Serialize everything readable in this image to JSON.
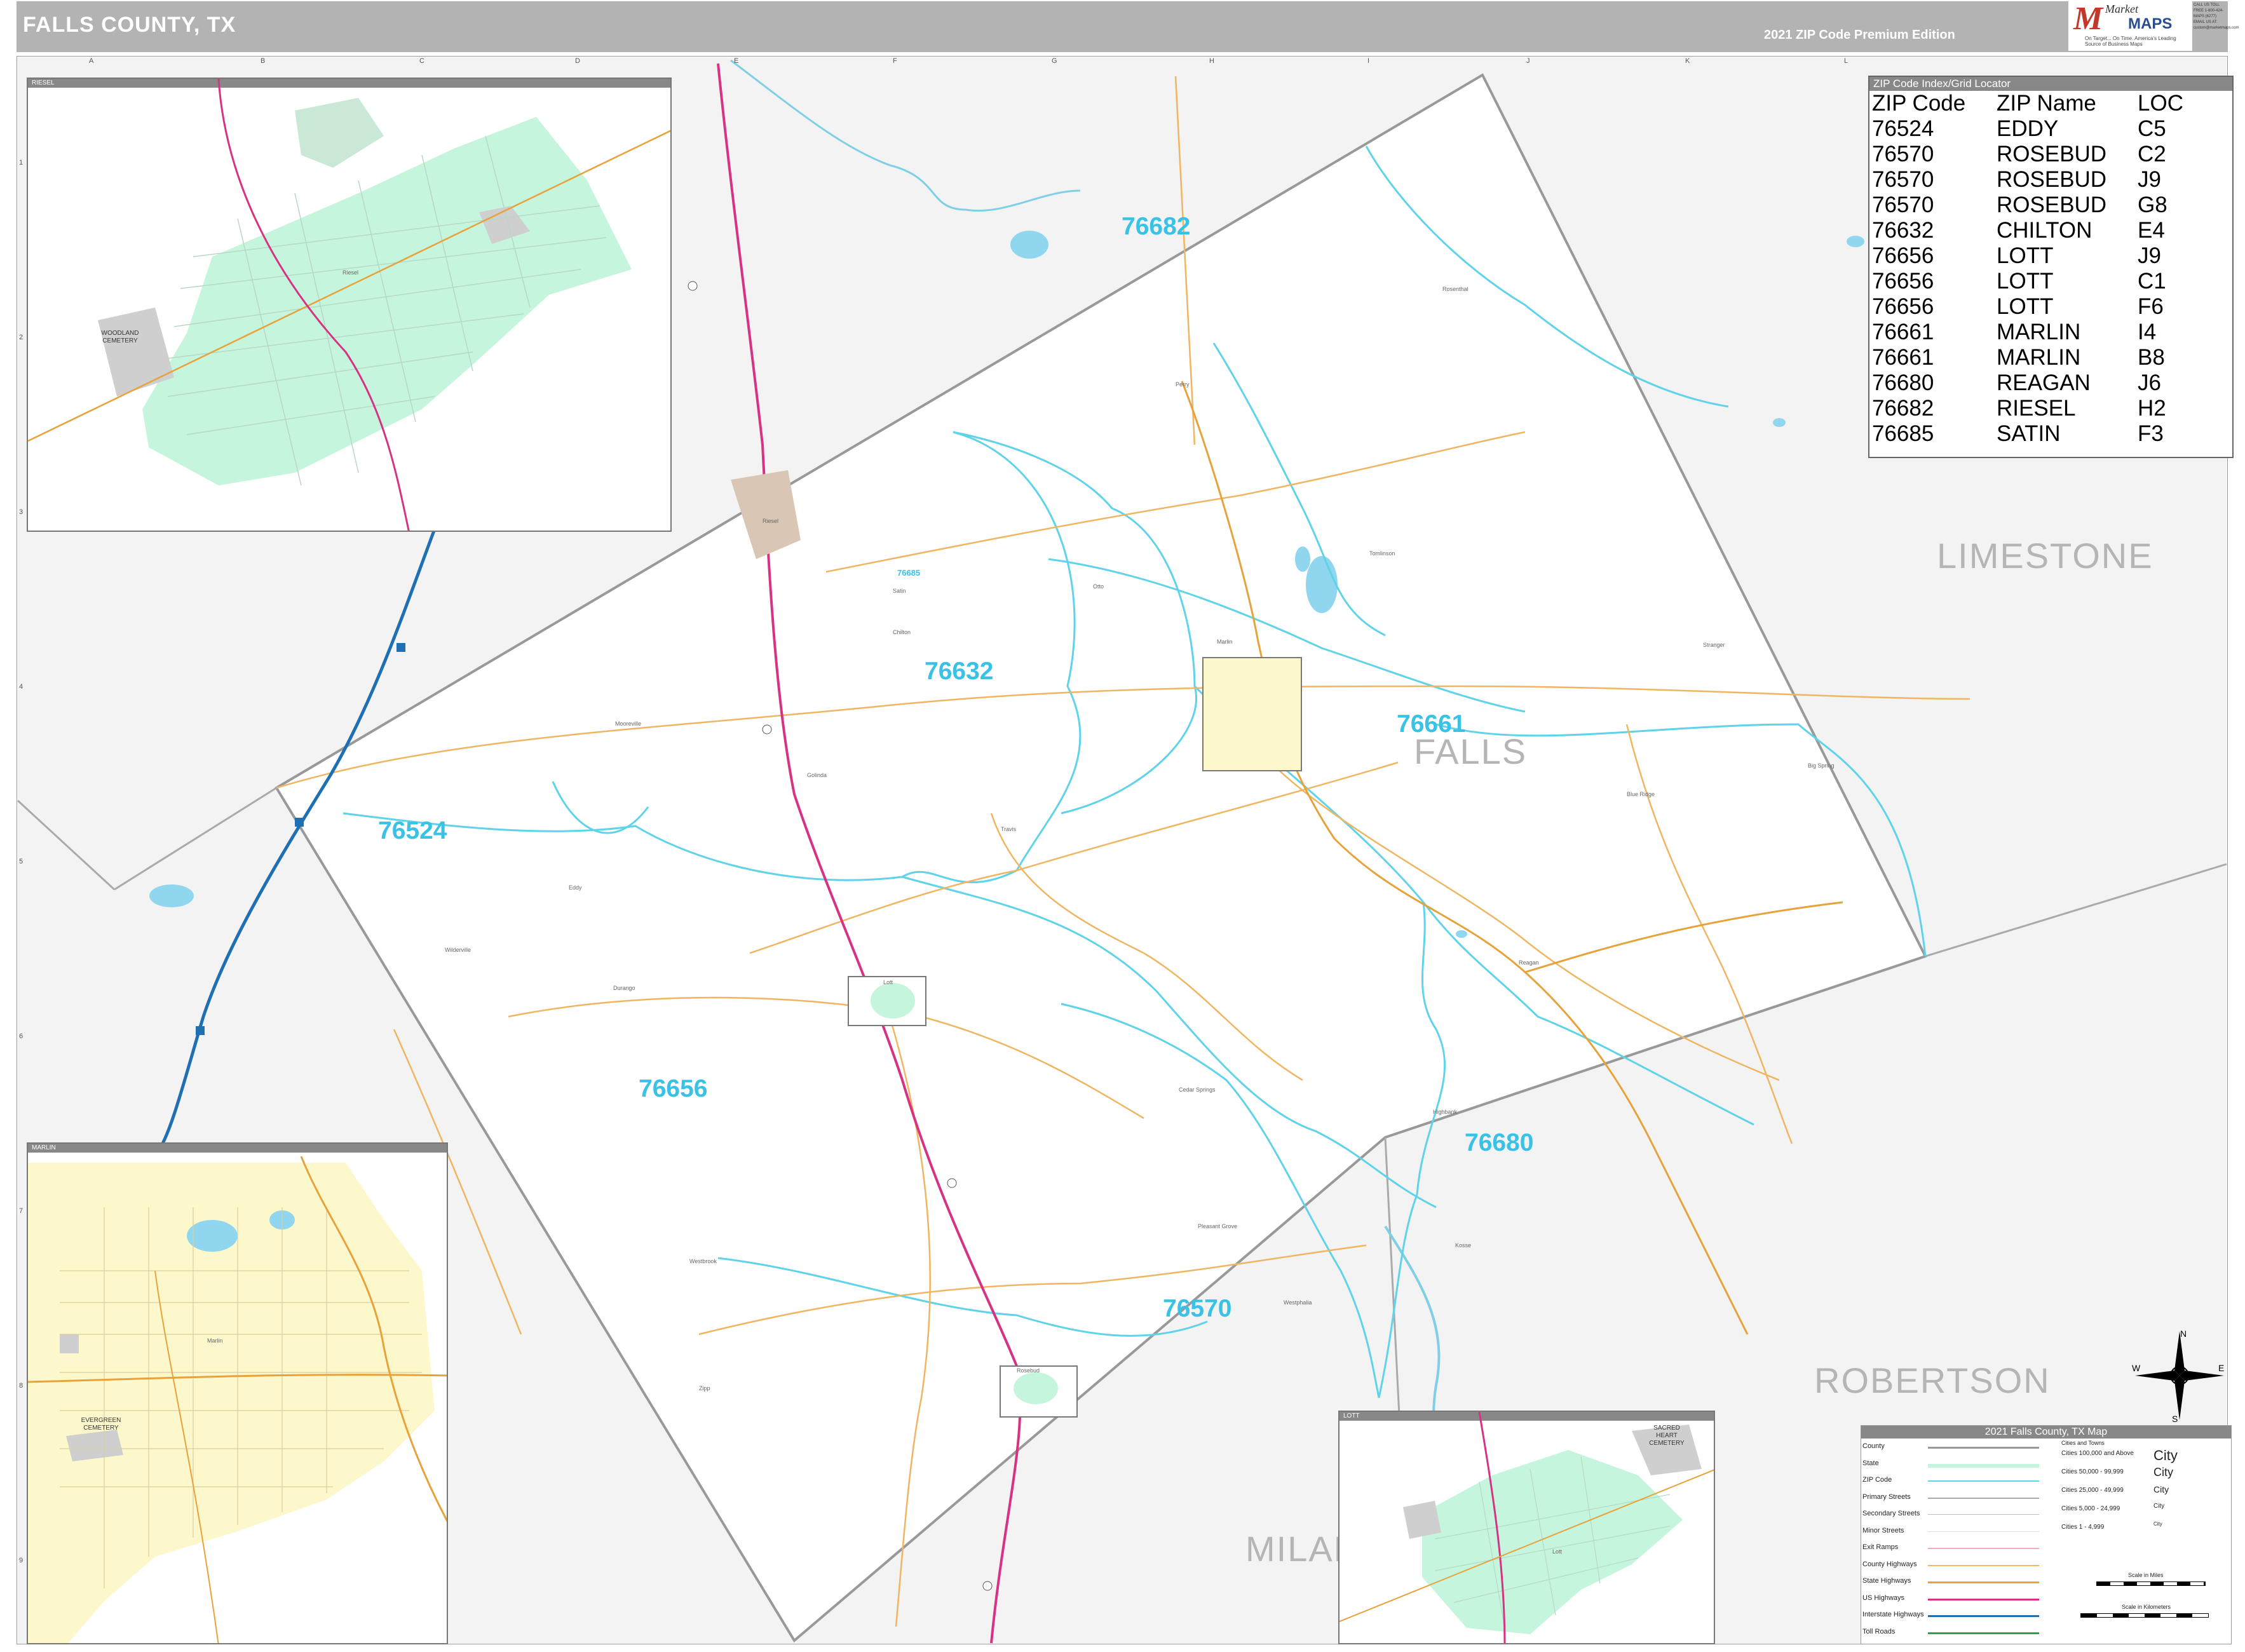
{
  "header": {
    "title": "FALLS COUNTY, TX",
    "edition": "2021 ZIP Code Premium Edition",
    "logo_top": "Market",
    "logo_main": "MAPS",
    "logo_tagline": "On Target... On Time. America's Leading Source of Business Maps",
    "logo_contact": "CALL US TOLL FREE 1-800-424-MAPS (6277) EMAIL US AT: custom@marketmaps.com"
  },
  "grid": {
    "columns": [
      "A",
      "B",
      "C",
      "D",
      "E",
      "F",
      "G",
      "H",
      "I",
      "J",
      "K",
      "L"
    ],
    "rows": [
      "1",
      "2",
      "3",
      "4",
      "5",
      "6",
      "7",
      "8",
      "9"
    ]
  },
  "zip_labels": [
    {
      "zip": "76682"
    },
    {
      "zip": "76632"
    },
    {
      "zip": "76661"
    },
    {
      "zip": "76524"
    },
    {
      "zip": "76656"
    },
    {
      "zip": "76680"
    },
    {
      "zip": "76570"
    },
    {
      "zip": "76685"
    }
  ],
  "county_labels": {
    "falls": "FALLS",
    "limestone": "LIMESTONE",
    "robertson": "ROBERTSON",
    "milam": "MILAM"
  },
  "places": {
    "marlin": "Marlin",
    "rosebud": "Rosebud",
    "lott": "Lott",
    "chilton": "Chilton",
    "reagan": "Reagan",
    "riesel": "Riesel",
    "satin": "Satin",
    "eddy": "Eddy",
    "golinda": "Golinda",
    "perry": "Perry",
    "mooreville": "Mooreville",
    "otto": "Otto",
    "travis": "Travis",
    "cedar_springs": "Cedar Springs",
    "durango": "Durango",
    "blue_ridge": "Blue Ridge",
    "big_spring": "Big Spring",
    "pleasant_grove": "Pleasant Grove",
    "westbrook": "Westbrook",
    "highbank": "Highbank",
    "kosse": "Kosse",
    "bremond": "Bremond",
    "zipp": "Zipp",
    "westphalia": "Westphalia",
    "stranger": "Stranger",
    "tomlinson": "Tomlinson",
    "rosenthal": "Rosenthal",
    "wilderville": "Wilderville"
  },
  "insets": {
    "riesel": {
      "title": "RIESEL",
      "cemetery": "WOODLAND CEMETERY",
      "town": "Riesel"
    },
    "marlin": {
      "title": "MARLIN",
      "cemetery": "EVERGREEN CEMETERY",
      "town": "Marlin"
    },
    "lott": {
      "title": "LOTT",
      "cemetery": "SACRED HEART CEMETERY",
      "town": "Lott"
    }
  },
  "zip_index": {
    "title": "ZIP Code Index/Grid Locator",
    "headers": [
      "ZIP Code",
      "ZIP Name",
      "LOC"
    ],
    "rows": [
      [
        "76524",
        "EDDY",
        "C5"
      ],
      [
        "76570",
        "ROSEBUD",
        "C2"
      ],
      [
        "76570",
        "ROSEBUD",
        "J9"
      ],
      [
        "76570",
        "ROSEBUD",
        "G8"
      ],
      [
        "76632",
        "CHILTON",
        "E4"
      ],
      [
        "76656",
        "LOTT",
        "J9"
      ],
      [
        "76656",
        "LOTT",
        "C1"
      ],
      [
        "76656",
        "LOTT",
        "F6"
      ],
      [
        "76661",
        "MARLIN",
        "I4"
      ],
      [
        "76661",
        "MARLIN",
        "B8"
      ],
      [
        "76680",
        "REAGAN",
        "J6"
      ],
      [
        "76682",
        "RIESEL",
        "H2"
      ],
      [
        "76685",
        "SATIN",
        "F3"
      ]
    ]
  },
  "legend": {
    "title": "2021 Falls County, TX Map",
    "left_items": [
      "County",
      "State",
      "ZIP Code",
      "Primary Streets",
      "Secondary Streets",
      "Minor Streets",
      "Exit Ramps",
      "County Highways",
      "State Highways",
      "US Highways",
      "Interstate Highways",
      "Toll Roads"
    ],
    "cities_header": "Cities and Towns",
    "cities": [
      {
        "range": "Cities 100,000 and Above",
        "sample": "City"
      },
      {
        "range": "Cities 50,000 - 99,999",
        "sample": "City"
      },
      {
        "range": "Cities 25,000 - 49,999",
        "sample": "City"
      },
      {
        "range": "Cities 5,000 - 24,999",
        "sample": "City"
      },
      {
        "range": "Cities 1 - 4,999",
        "sample": "City"
      }
    ],
    "scale_miles": "Scale in Miles",
    "scale_km": "Scale in Kilometers"
  },
  "compass": {
    "n": "N",
    "s": "S",
    "e": "E",
    "w": "W"
  },
  "colors": {
    "county_fill": "#f3f3f3",
    "falls_fill": "#ffffff",
    "zip_boundary": "#5fd3ea",
    "zip_label": "#39c2e6",
    "county_line": "#999999",
    "state_hwy": "#e8a23a",
    "us_hwy": "#d63384",
    "interstate": "#1f6fb3",
    "water": "#8fd6ee",
    "city_yellow": "#fdf8cc",
    "city_green": "#c6f5dd"
  }
}
